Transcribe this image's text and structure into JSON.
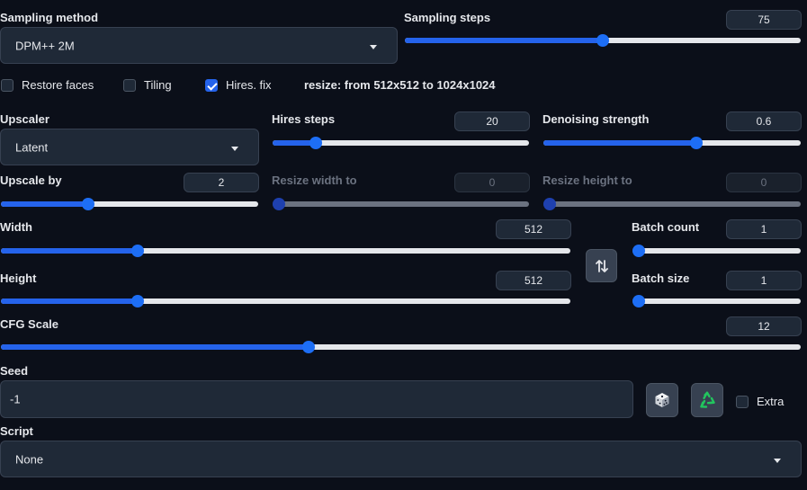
{
  "sampling": {
    "method_label": "Sampling method",
    "method_value": "DPM++ 2M",
    "steps_label": "Sampling steps",
    "steps_value": "75",
    "steps_fraction": 0.5
  },
  "options": {
    "restore_faces": {
      "label": "Restore faces",
      "checked": false
    },
    "tiling": {
      "label": "Tiling",
      "checked": false
    },
    "hires_fix": {
      "label": "Hires. fix",
      "checked": true
    },
    "resize_info": {
      "prefix": "resize: from ",
      "from": "512x512",
      "mid": " to ",
      "to": "1024x1024"
    }
  },
  "hires": {
    "upscaler_label": "Upscaler",
    "upscaler_value": "Latent",
    "steps_label": "Hires steps",
    "steps_value": "20",
    "steps_fraction": 0.15,
    "denoise_label": "Denoising strength",
    "denoise_value": "0.6",
    "denoise_fraction": 0.6,
    "upscale_by_label": "Upscale by",
    "upscale_by_value": "2",
    "upscale_by_fraction": 0.33,
    "resize_width_label": "Resize width to",
    "resize_width_value": "0",
    "resize_height_label": "Resize height to",
    "resize_height_value": "0"
  },
  "dimensions": {
    "width_label": "Width",
    "width_value": "512",
    "width_fraction": 0.234,
    "height_label": "Height",
    "height_value": "512",
    "height_fraction": 0.234,
    "swap_icon": "swap-vertical-arrows-icon"
  },
  "batch": {
    "count_label": "Batch count",
    "count_value": "1",
    "count_fraction": 0,
    "size_label": "Batch size",
    "size_value": "1",
    "size_fraction": 0
  },
  "cfg": {
    "label": "CFG Scale",
    "value": "12",
    "fraction": 0.383
  },
  "seed": {
    "label": "Seed",
    "value": "-1",
    "random_icon": "dice-icon",
    "reuse_icon": "recycle-icon",
    "extra_label": "Extra",
    "extra_checked": false
  },
  "script": {
    "label": "Script",
    "value": "None"
  },
  "colors": {
    "background": "#0b0f19",
    "accent": "#2563eb",
    "input_bg": "#1f2937",
    "recycle_green": "#22c55e"
  }
}
